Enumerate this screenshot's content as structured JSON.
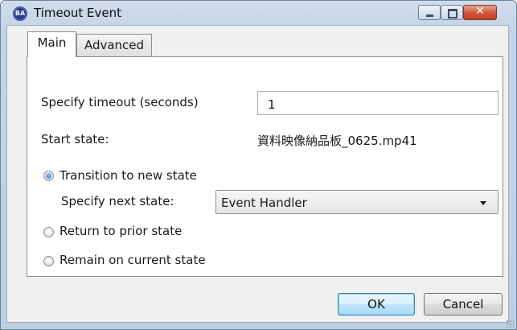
{
  "window": {
    "title": "Timeout Event",
    "app_icon_text": "BA"
  },
  "tabs": [
    {
      "label": "Main",
      "selected": true
    },
    {
      "label": "Advanced",
      "selected": false
    }
  ],
  "main": {
    "timeout_label": "Specify timeout (seconds)",
    "timeout_value": "1",
    "start_state_label": "Start state:",
    "start_state_value": "資料映像納品板_0625.mp41",
    "options": [
      {
        "label": "Transition to new state",
        "checked": true
      },
      {
        "label": "Return to prior state",
        "checked": false
      },
      {
        "label": "Remain on current state",
        "checked": false
      }
    ],
    "next_state_label": "Specify next state:",
    "next_state_value": "Event Handler"
  },
  "buttons": {
    "ok": "OK",
    "cancel": "Cancel"
  },
  "colors": {
    "frame": "#c3d4e6",
    "close_button": "#c8472d",
    "radio_selected": "#2a67b0"
  }
}
